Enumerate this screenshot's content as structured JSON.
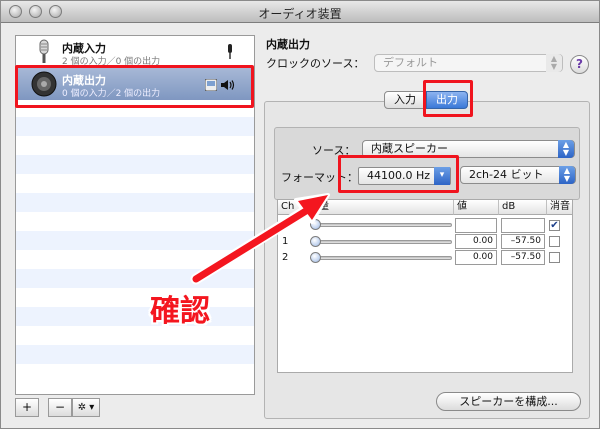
{
  "window": {
    "title": "オーディオ装置"
  },
  "devices": [
    {
      "name": "内蔵入力",
      "sub": "2 個の入力／0 個の出力",
      "icon": "microphone-icon"
    },
    {
      "name": "内蔵出力",
      "sub": "0 個の入力／2 個の出力",
      "icon": "speaker-icon"
    }
  ],
  "toolbar": {
    "add": "+",
    "remove": "−",
    "gear": "✲ ▾"
  },
  "detail": {
    "title": "内蔵出力",
    "clock_label": "クロックのソース：",
    "clock_value": "デフォルト",
    "help": "?",
    "tabs": [
      "入力",
      "出力"
    ],
    "source_label": "ソース：",
    "source_value": "内蔵スピーカー",
    "format_label": "フォーマット：",
    "format_value": "44100.0 Hz",
    "bits_value": "2ch-24 ビット",
    "configure_button": "スピーカーを構成..."
  },
  "table": {
    "headers": [
      "Ch",
      "音量",
      "値",
      "dB",
      "消音"
    ],
    "rows": [
      {
        "ch": "",
        "value": "",
        "db": "",
        "mute": true,
        "level": 0
      },
      {
        "ch": "1",
        "value": "0.00",
        "db": "–57.50",
        "mute": false,
        "level": 0
      },
      {
        "ch": "2",
        "value": "0.00",
        "db": "–57.50",
        "mute": false,
        "level": 0
      }
    ]
  },
  "annotation": {
    "label": "確認"
  },
  "colors": {
    "highlight": "#f0141e",
    "selection": "#8ea3c9"
  }
}
